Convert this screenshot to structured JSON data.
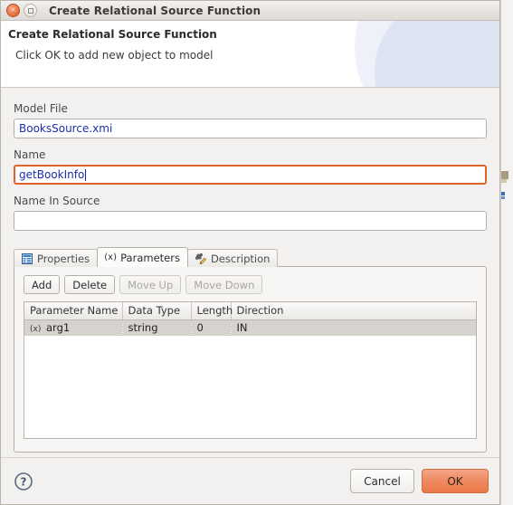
{
  "window": {
    "title": "Create Relational Source Function",
    "close_icon": "close-icon",
    "maximize_icon": "maximize-icon"
  },
  "banner": {
    "title": "Create Relational Source Function",
    "subtitle": "Click OK to add new object to model"
  },
  "form": {
    "model_file": {
      "label": "Model File",
      "value": "BooksSource.xmi",
      "placeholder": ""
    },
    "name": {
      "label": "Name",
      "value": "getBookInfo",
      "placeholder": "",
      "focused": true,
      "focus_color": "#e0642a"
    },
    "name_in_source": {
      "label": "Name In Source",
      "value": "",
      "placeholder": ""
    }
  },
  "tabs": [
    {
      "label": "Properties",
      "icon": "table-properties-icon",
      "active": false
    },
    {
      "label": "Parameters",
      "icon": "parameter-icon",
      "active": true
    },
    {
      "label": "Description",
      "icon": "description-pencil-icon",
      "active": false
    }
  ],
  "parameters_panel": {
    "buttons": [
      {
        "label": "Add",
        "enabled": true
      },
      {
        "label": "Delete",
        "enabled": true
      },
      {
        "label": "Move Up",
        "enabled": false
      },
      {
        "label": "Move Down",
        "enabled": false
      }
    ],
    "table": {
      "columns": [
        "Parameter Name",
        "Data Type",
        "Length",
        "Direction"
      ],
      "rows": [
        {
          "icon": "parameter-icon",
          "cells": [
            "arg1",
            "string",
            "0",
            "IN"
          ],
          "selected": true
        }
      ]
    }
  },
  "footer": {
    "help_icon": "help-question-icon",
    "cancel_label": "Cancel",
    "ok_label": "OK",
    "ok_color": "#ef8a62"
  }
}
